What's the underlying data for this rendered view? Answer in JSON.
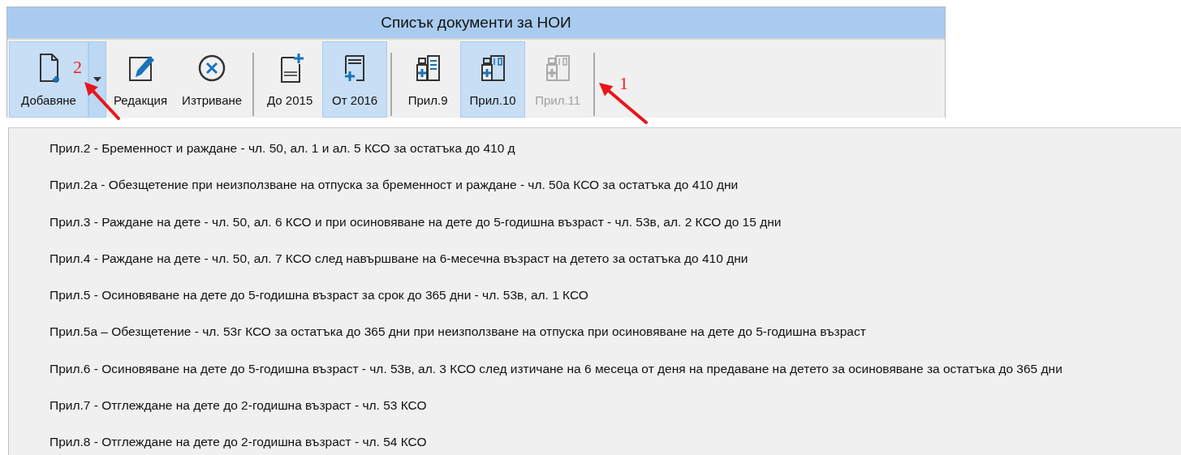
{
  "window": {
    "title": "Списък документи за НОИ"
  },
  "toolbar": {
    "groups": [
      {
        "buttons": [
          {
            "label": "Добавяне",
            "kind": "new-doc",
            "selected": true,
            "disabled": false,
            "split": true
          },
          {
            "label": "Редакция",
            "kind": "edit",
            "selected": false,
            "disabled": false,
            "split": false
          },
          {
            "label": "Изтриване",
            "kind": "delete",
            "selected": false,
            "disabled": false,
            "split": false
          }
        ]
      },
      {
        "buttons": [
          {
            "label": "До 2015",
            "kind": "cal-top",
            "selected": false,
            "disabled": false,
            "split": false
          },
          {
            "label": "От 2016",
            "kind": "cal-bottom",
            "selected": true,
            "disabled": false,
            "split": false
          }
        ]
      },
      {
        "buttons": [
          {
            "label": "Прил.9",
            "kind": "bottle-list",
            "selected": false,
            "disabled": false,
            "split": false
          },
          {
            "label": "Прил.10",
            "kind": "bottle-num",
            "selected": true,
            "disabled": false,
            "split": false
          },
          {
            "label": "Прил.11",
            "kind": "bottle-num",
            "selected": false,
            "disabled": true,
            "split": false
          }
        ]
      }
    ]
  },
  "menu": {
    "items": [
      {
        "label": "Прил.2 - Бременност и раждане - чл. 50, ал. 1 и ал. 5 КСО за остатъка до 410 д"
      },
      {
        "label": "Прил.2а - Обезщетение при неизползване на отпуска за бременност и раждане - чл. 50а КСО за остатъка до 410 дни"
      },
      {
        "label": "Прил.3 - Раждане на дете - чл. 50, ал. 6 КСО и при осиновяване на дете до 5-годишна възраст - чл. 53в, ал. 2 КСО до 15 дни"
      },
      {
        "label": "Прил.4 - Раждане на дете - чл. 50, ал. 7 КСО след навършване на 6-месечна възраст на детето за остатъка до 410 дни"
      },
      {
        "label": "Прил.5 - Осиновяване на дете до 5-годишна възраст за срок до 365 дни - чл. 53в, ал. 1 КСО"
      },
      {
        "label": "Прил.5а – Обезщетение - чл. 53г КСО за остатъка до 365 дни при неизползване на отпуска при осиновяване на дете до 5-годишна възраст"
      },
      {
        "label": "Прил.6 - Осиновяване на дете до 5-годишна възраст - чл. 53в, ал. 3 КСО след изтичане на 6 месеца от деня на предаване на детето за осиновяване за остатъка до 365 дни"
      },
      {
        "label": "Прил.7 - Отглеждане на дете до 2-годишна възраст - чл. 53 КСО"
      },
      {
        "label": "Прил.8 - Отглеждане на дете до 2-годишна възраст - чл. 54 КСО"
      }
    ]
  },
  "annotations": [
    {
      "number": "2"
    },
    {
      "number": "1"
    }
  ]
}
